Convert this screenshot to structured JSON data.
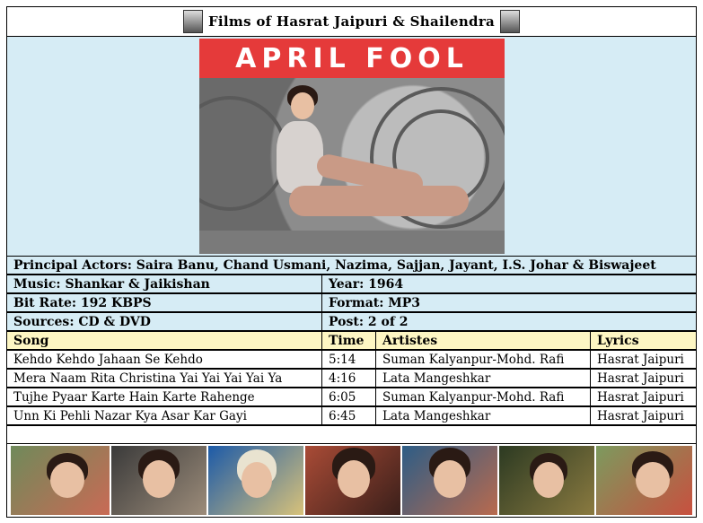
{
  "header": {
    "title": "Films of Hasrat Jaipuri & Shailendra",
    "left_portrait_icon": "portrait-icon",
    "right_portrait_icon": "portrait-icon"
  },
  "poster": {
    "banner_text": "APRIL FOOL",
    "banner_color": "#e53a3a"
  },
  "info": {
    "actors": "Principal Actors: Saira Banu, Chand Usmani, Nazima, Sajjan, Jayant, I.S. Johar & Biswajeet",
    "music": "Music: Shankar & Jaikishan",
    "year": "Year: 1964",
    "bitrate": "Bit Rate: 192 KBPS",
    "format": "Format: MP3",
    "sources": "Sources: CD & DVD",
    "post": "Post: 2 of 2"
  },
  "songs": {
    "headers": [
      "Song",
      "Time",
      "Artistes",
      "Lyrics"
    ],
    "rows": [
      [
        "Kehdo Kehdo Jahaan Se Kehdo",
        "5:14",
        "Suman Kalyanpur-Mohd. Rafi",
        "Hasrat Jaipuri"
      ],
      [
        "Mera Naam Rita Christina Yai Yai Yai Yai Ya",
        "4:16",
        "Lata Mangeshkar",
        "Hasrat Jaipuri"
      ],
      [
        "Tujhe Pyaar Karte Hain Karte Rahenge",
        "6:05",
        "Suman Kalyanpur-Mohd. Rafi",
        "Hasrat Jaipuri"
      ],
      [
        "Unn Ki Pehli Nazar Kya Asar Kar Gayi",
        "6:45",
        "Lata Mangeshkar",
        "Hasrat Jaipuri"
      ]
    ]
  },
  "colors": {
    "info_bg": "#d6ecf5",
    "header_bg": "#fdf6c3"
  }
}
